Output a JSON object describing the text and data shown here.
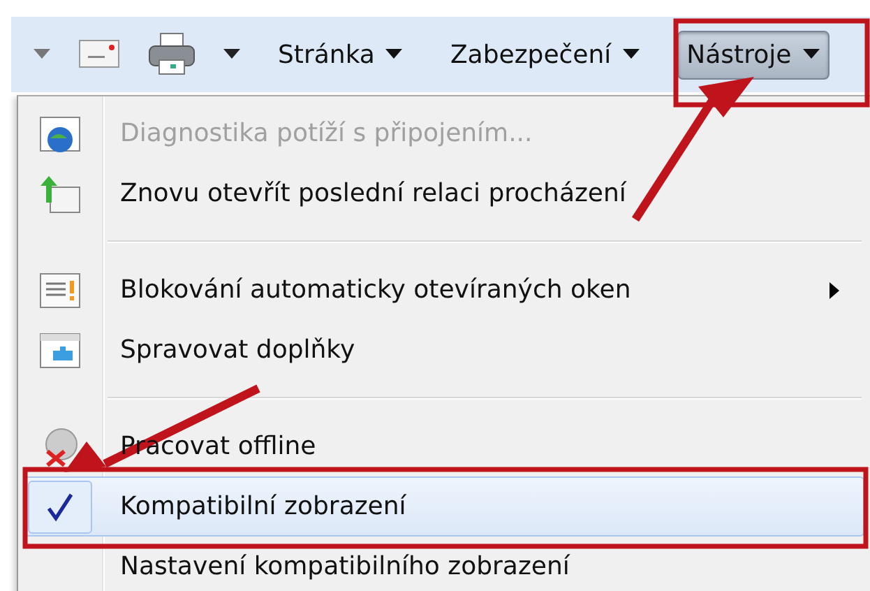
{
  "toolbar": {
    "buttons": [
      {
        "kind": "dropdown-arrow"
      },
      {
        "kind": "mail"
      },
      {
        "kind": "printer"
      },
      {
        "kind": "dropdown-arrow"
      },
      {
        "kind": "menu",
        "label": "Stránka",
        "pressed": false
      },
      {
        "kind": "menu",
        "label": "Zabezpečení",
        "pressed": false
      },
      {
        "kind": "menu",
        "label": "Nástroje",
        "pressed": true
      }
    ]
  },
  "menu": {
    "items": [
      {
        "kind": "item",
        "label": "Diagnostika potíží s připojením...",
        "disabled": true,
        "checked": false,
        "submenu": false,
        "selected": false
      },
      {
        "kind": "item",
        "label": "Znovu otevřít poslední relaci procházení",
        "disabled": false,
        "checked": false,
        "submenu": false,
        "selected": false
      },
      {
        "kind": "separator"
      },
      {
        "kind": "item",
        "label": "Blokování automaticky otevíraných oken",
        "disabled": false,
        "checked": false,
        "submenu": true,
        "selected": false
      },
      {
        "kind": "item",
        "label": "Spravovat doplňky",
        "disabled": false,
        "checked": false,
        "submenu": false,
        "selected": false
      },
      {
        "kind": "separator"
      },
      {
        "kind": "item",
        "label": "Pracovat offline",
        "disabled": false,
        "checked": false,
        "submenu": false,
        "selected": false
      },
      {
        "kind": "item",
        "label": "Kompatibilní zobrazení",
        "disabled": false,
        "checked": true,
        "submenu": false,
        "selected": true
      },
      {
        "kind": "item",
        "label": "Nastavení kompatibilního zobrazení",
        "disabled": false,
        "checked": false,
        "submenu": false,
        "selected": false
      }
    ]
  }
}
